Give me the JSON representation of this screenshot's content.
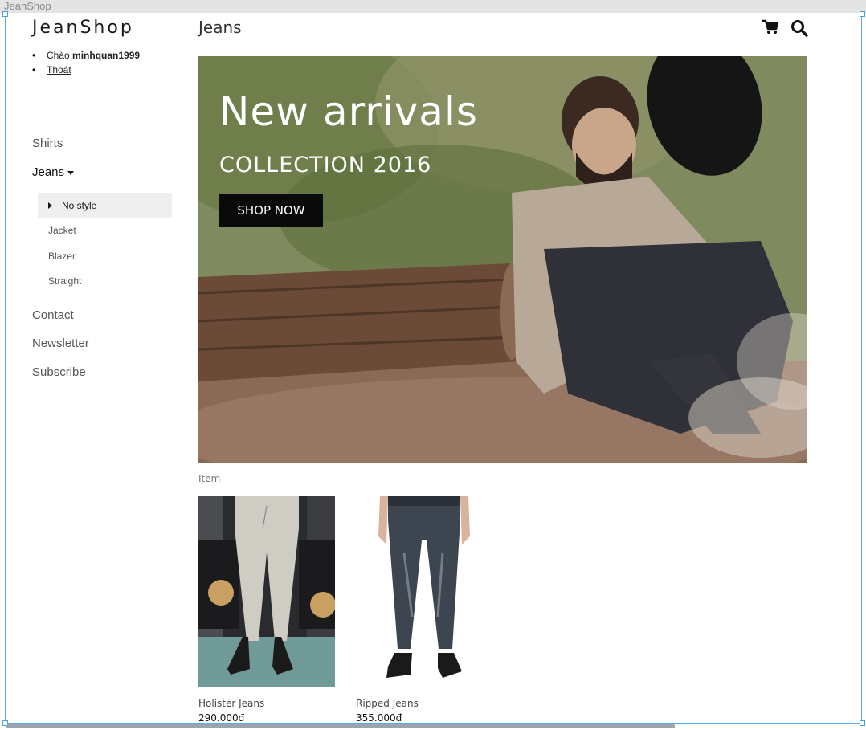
{
  "window": {
    "title": "JeanShop"
  },
  "sidebar": {
    "brand": "JeanShop",
    "greeting_prefix": "Chào",
    "username": "minhquan1999",
    "logout": "Thoát",
    "nav": [
      {
        "label": "Shirts"
      },
      {
        "label": "Jeans"
      },
      {
        "label": "Contact"
      },
      {
        "label": "Newsletter"
      },
      {
        "label": "Subscribe"
      }
    ],
    "jeans_sub": [
      {
        "label": "No style",
        "active": true
      },
      {
        "label": "Jacket"
      },
      {
        "label": "Blazer"
      },
      {
        "label": "Straight"
      }
    ]
  },
  "header": {
    "title": "Jeans",
    "icons": [
      "cart-icon",
      "search-icon"
    ]
  },
  "hero": {
    "title": "New arrivals",
    "subtitle": "COLLECTION 2016",
    "button": "SHOP NOW"
  },
  "products": {
    "section_label": "Item",
    "items": [
      {
        "name": "Holister Jeans",
        "price": "290.000đ"
      },
      {
        "name": "Ripped Jeans",
        "price": "355.000đ"
      }
    ]
  },
  "colors": {
    "selection": "#5aa9e6",
    "button": "#0a0a0a",
    "active_bg": "#efefef"
  }
}
